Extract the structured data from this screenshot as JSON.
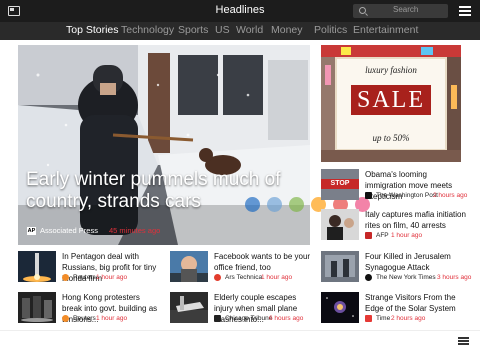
{
  "app": {
    "title": "Headlines"
  },
  "search": {
    "placeholder": "Search"
  },
  "tabs": [
    "Top Stories",
    "Technology",
    "Sports",
    "US",
    "World",
    "Money",
    "Politics",
    "Entertainment"
  ],
  "hero": {
    "title": "Early winter pummels much of country, strands cars",
    "source": "Associated Press",
    "source_badge": "AP",
    "time": "45 minutes ago"
  },
  "ad": {
    "line1": "luxury fashion",
    "line2": "SALE",
    "line3": "up to 50%"
  },
  "stories": [
    {
      "title": "In Pentagon deal with Russians, big profit for tiny Florida firm",
      "source": "Reuters",
      "time": "1 hour ago"
    },
    {
      "title": "Facebook wants to be your office friend, too",
      "source": "Ars Technica",
      "time": "1 hour ago"
    },
    {
      "title": "Hong Kong protesters break into govt. building as tensions...",
      "source": "Reuters",
      "time": "1 hour ago"
    },
    {
      "title": "Elderly couple escapes injury when small plane crashes into...",
      "source": "Chicago Tribune",
      "time": "6 hours ago"
    }
  ],
  "side_stories": [
    {
      "title": "Obama's looming immigration move meets skepticism",
      "source": "The Washington Post",
      "time": "2 hours ago",
      "thumb_text": "STOP"
    },
    {
      "title": "Italy captures mafia initiation rites on film, 40 arrests",
      "source": "AFP",
      "time": "1 hour ago"
    },
    {
      "title": "Four Killed in Jerusalem Synagogue Attack",
      "source": "The New York Times",
      "time": "3 hours ago"
    },
    {
      "title": "Strange Visitors From the Edge of the Solar System",
      "source": "Time",
      "time": "2 hours ago"
    }
  ],
  "colors": {
    "accent": "#e0303a",
    "topbar": "#1c1c1c",
    "tabbar": "#2a2a2a"
  }
}
